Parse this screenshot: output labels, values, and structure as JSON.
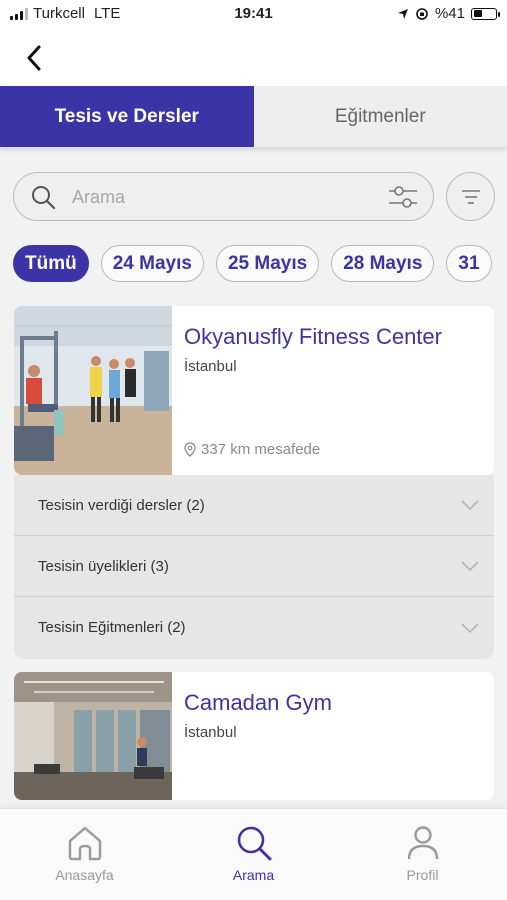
{
  "status_bar": {
    "carrier": "Turkcell",
    "network": "LTE",
    "time": "19:41",
    "battery": "%41",
    "battery_level": 0.41
  },
  "header": {
    "back_icon": "chevron-left-icon"
  },
  "tabs": [
    {
      "label": "Tesis ve Dersler",
      "active": true
    },
    {
      "label": "Eğitmenler",
      "active": false
    }
  ],
  "search": {
    "placeholder": "Arama",
    "value": ""
  },
  "date_chips": [
    {
      "label": "Tümü",
      "active": true
    },
    {
      "label": "24 Mayıs",
      "active": false
    },
    {
      "label": "25 Mayıs",
      "active": false
    },
    {
      "label": "28 Mayıs",
      "active": false
    },
    {
      "label": "31",
      "active": false
    }
  ],
  "facilities": [
    {
      "name": "Okyanusfly Fitness Center",
      "city": "İstanbul",
      "distance": "337 km mesafede",
      "sections": [
        {
          "label": "Tesisin verdiği dersler (2)"
        },
        {
          "label": "Tesisin üyelikleri (3)"
        },
        {
          "label": "Tesisin Eğitmenleri (2)"
        }
      ]
    },
    {
      "name": "Camadan Gym",
      "city": "İstanbul"
    }
  ],
  "bottom_nav": [
    {
      "label": "Anasayfa",
      "icon": "home-icon",
      "active": false
    },
    {
      "label": "Arama",
      "icon": "search-icon",
      "active": true
    },
    {
      "label": "Profil",
      "icon": "profile-icon",
      "active": false
    }
  ],
  "colors": {
    "accent": "#3b34a6",
    "background": "#f2f2f2",
    "accordion": "#e6e6e6"
  }
}
